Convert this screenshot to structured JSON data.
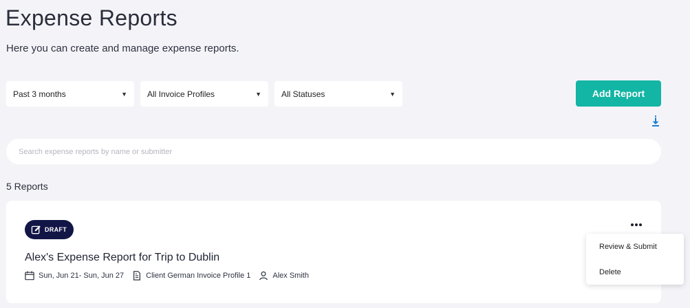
{
  "header": {
    "title": "Expense Reports",
    "subtitle": "Here you can create and manage expense reports."
  },
  "filters": {
    "period": "Past 3 months",
    "invoice_profile": "All Invoice Profiles",
    "status": "All Statuses"
  },
  "actions": {
    "add_report_label": "Add Report",
    "download_icon": "download-arrow-icon"
  },
  "search": {
    "placeholder": "Search expense reports by name or submitter",
    "value": ""
  },
  "reports_count_label": "5 Reports",
  "reports": [
    {
      "status_badge": "DRAFT",
      "title": "Alex's Expense Report for Trip to Dublin",
      "date_range": "Sun, Jun 21- Sun, Jun 27",
      "invoice_profile": "Client German Invoice Profile 1",
      "submitter": "Alex Smith"
    }
  ],
  "context_menu": {
    "items": [
      {
        "label": "Review & Submit"
      },
      {
        "label": "Delete"
      }
    ]
  },
  "colors": {
    "background": "#f4f4f8",
    "accent": "#13b5a4",
    "badge": "#121646",
    "download_icon": "#1f7fd1"
  }
}
